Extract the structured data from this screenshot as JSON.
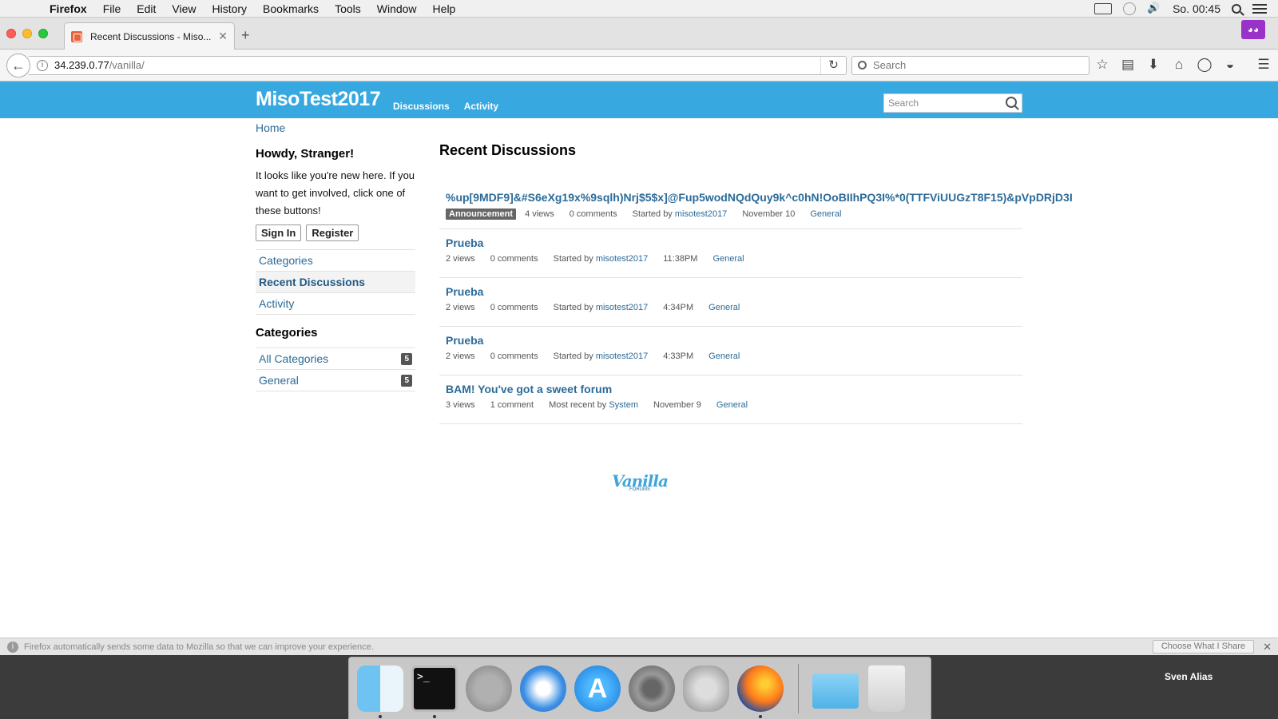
{
  "menubar": {
    "app_name": "Firefox",
    "items": [
      "File",
      "Edit",
      "View",
      "History",
      "Bookmarks",
      "Tools",
      "Window",
      "Help"
    ],
    "clock": "So. 00:45"
  },
  "browser": {
    "tab_title": "Recent Discussions - Miso...",
    "url_host": "34.239.0.77",
    "url_path": "/vanilla/",
    "search_placeholder": "Search"
  },
  "site": {
    "title": "MisoTest2017",
    "nav": [
      "Discussions",
      "Activity"
    ],
    "search_placeholder": "Search"
  },
  "breadcrumb": "Home",
  "sidebar": {
    "howdy": "Howdy, Stranger!",
    "intro": "It looks like you're new here. If you want to get involved, click one of these buttons!",
    "sign_in": "Sign In",
    "register": "Register",
    "nav": [
      {
        "label": "Categories",
        "active": false
      },
      {
        "label": "Recent Discussions",
        "active": true
      },
      {
        "label": "Activity",
        "active": false
      }
    ],
    "categories_heading": "Categories",
    "categories": [
      {
        "label": "All Categories",
        "count": "5"
      },
      {
        "label": "General",
        "count": "5"
      }
    ]
  },
  "content": {
    "heading": "Recent Discussions",
    "discussions": [
      {
        "title": "%up[9MDF9]&#S6eXg19x%9sqlh)Nrj$5$x]@Fup5wodNQdQuy9k^c0hN!OoBIIhPQ3I%*0(TTFViUUGzT8F15)&pVpDRjD3I",
        "badge": "Announcement",
        "views": "4 views",
        "comments": "0 comments",
        "by_label": "Started by",
        "author": "misotest2017",
        "date": "November 10",
        "category": "General"
      },
      {
        "title": "Prueba",
        "views": "2 views",
        "comments": "0 comments",
        "by_label": "Started by",
        "author": "misotest2017",
        "date": "11:38PM",
        "category": "General"
      },
      {
        "title": "Prueba",
        "views": "2 views",
        "comments": "0 comments",
        "by_label": "Started by",
        "author": "misotest2017",
        "date": "4:34PM",
        "category": "General"
      },
      {
        "title": "Prueba",
        "views": "2 views",
        "comments": "0 comments",
        "by_label": "Started by",
        "author": "misotest2017",
        "date": "4:33PM",
        "category": "General"
      },
      {
        "title": "BAM! You've got a sweet forum",
        "views": "3 views",
        "comments": "1 comment",
        "by_label": "Most recent by",
        "author": "System",
        "date": "November 9",
        "category": "General"
      }
    ]
  },
  "footer_logo": {
    "word": "Vanilla",
    "sub": "FORUMS"
  },
  "notification": {
    "text": "Firefox automatically sends some data to Mozilla so that we can improve your experience.",
    "button": "Choose What I Share"
  },
  "desktop": {
    "label": "Sven Alias"
  },
  "colors": {
    "header_blue": "#38a8e0",
    "link_blue": "#2b6b99"
  }
}
